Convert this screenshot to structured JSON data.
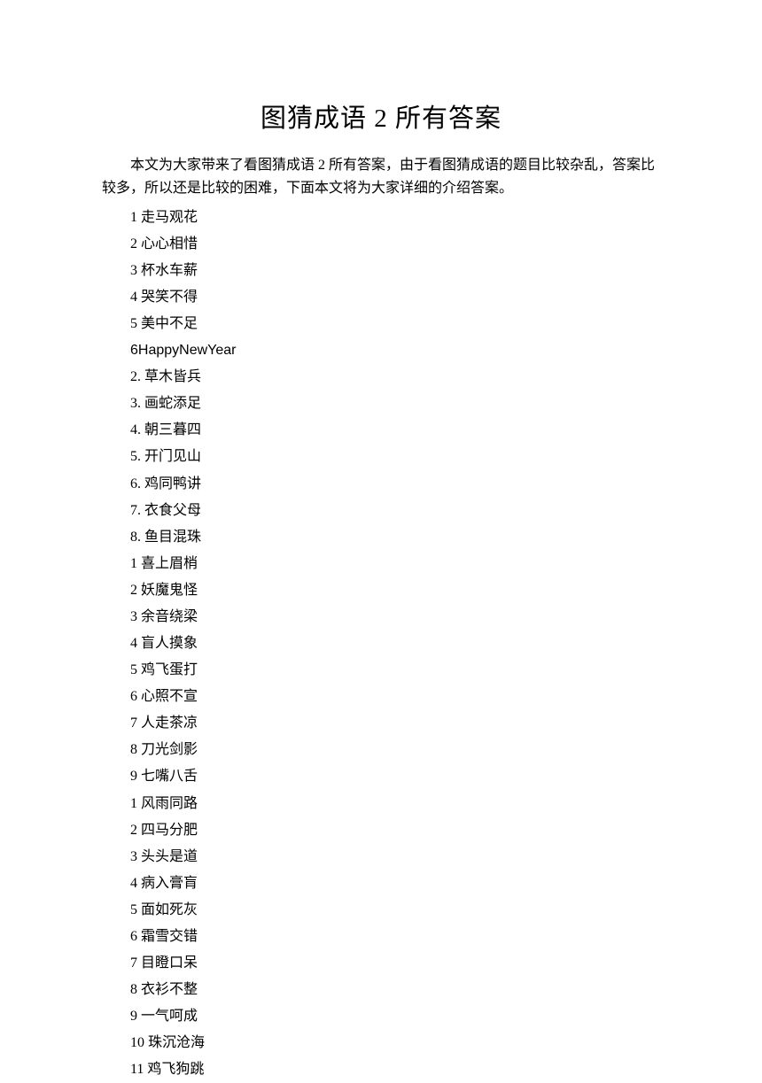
{
  "title": "图猜成语  2 所有答案",
  "intro": "本文为大家带来了看图猜成语 2 所有答案，由于看图猜成语的题目比较杂乱，答案比较多，所以还是比较的困难，下面本文将为大家详细的介绍答案。",
  "items": [
    "1 走马观花",
    "2 心心相惜",
    "3 杯水车薪",
    "4 哭笑不得",
    "5 美中不足",
    "6HappyNewYear",
    "2. 草木皆兵",
    "3. 画蛇添足",
    "4. 朝三暮四",
    "5. 开门见山",
    "6. 鸡同鸭讲",
    "7. 衣食父母",
    "8. 鱼目混珠",
    "1 喜上眉梢",
    "2 妖魔鬼怪",
    "3 余音绕梁",
    "4 盲人摸象",
    "5 鸡飞蛋打",
    "6 心照不宣",
    "7 人走茶凉",
    "8 刀光剑影",
    "9 七嘴八舌",
    "1 风雨同路",
    "2 四马分肥",
    "3 头头是道",
    "4 病入膏肓",
    "5 面如死灰",
    "6 霜雪交错",
    "7 目瞪口呆",
    "8 衣衫不整",
    "9 一气呵成",
    "10 珠沉沧海",
    "11 鸡飞狗跳"
  ]
}
